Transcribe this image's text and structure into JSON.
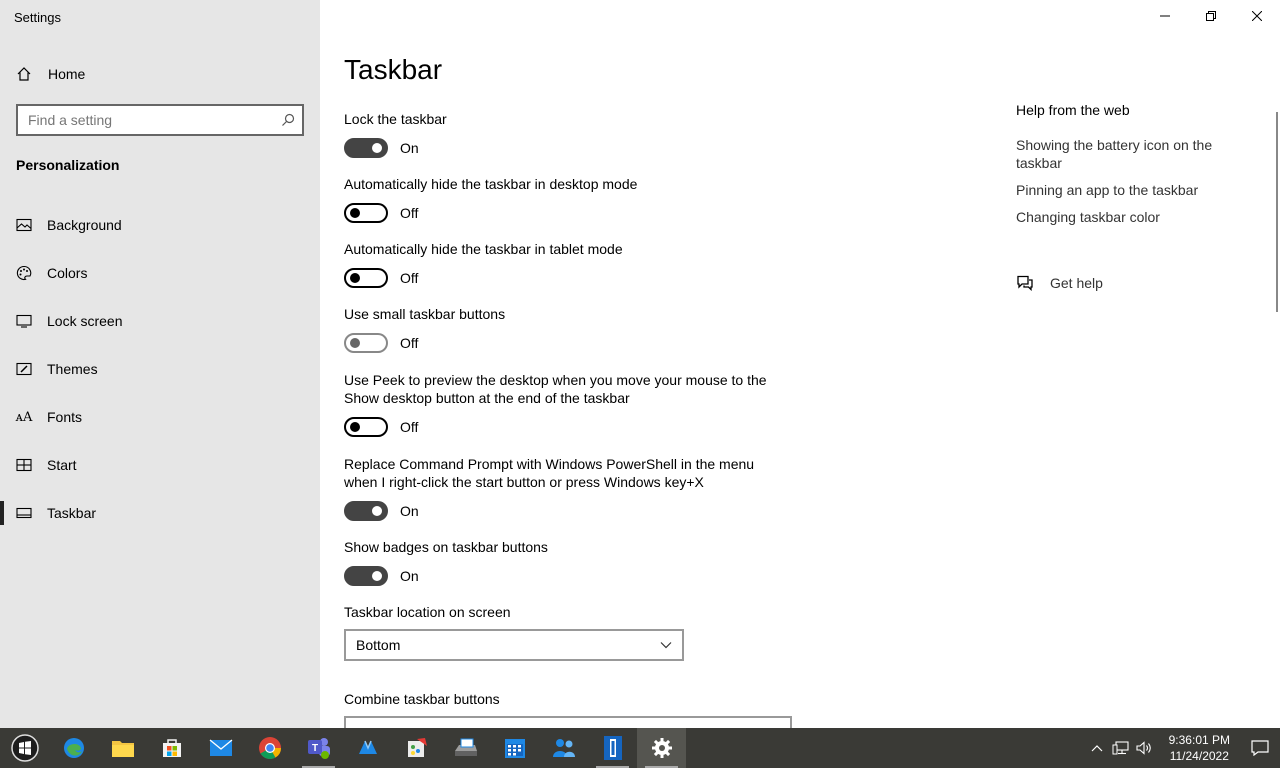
{
  "window": {
    "title": "Settings"
  },
  "sidebar": {
    "home_label": "Home",
    "search_placeholder": "Find a setting",
    "section_title": "Personalization",
    "items": [
      {
        "label": "Background",
        "icon": "picture-icon"
      },
      {
        "label": "Colors",
        "icon": "palette-icon"
      },
      {
        "label": "Lock screen",
        "icon": "monitor-icon"
      },
      {
        "label": "Themes",
        "icon": "brush-icon"
      },
      {
        "label": "Fonts",
        "icon": "font-icon"
      },
      {
        "label": "Start",
        "icon": "start-grid-icon"
      },
      {
        "label": "Taskbar",
        "icon": "taskbar-icon",
        "selected": true
      }
    ]
  },
  "main": {
    "title": "Taskbar",
    "settings": [
      {
        "label": "Lock the taskbar",
        "state": "On"
      },
      {
        "label": "Automatically hide the taskbar in desktop mode",
        "state": "Off"
      },
      {
        "label": "Automatically hide the taskbar in tablet mode",
        "state": "Off"
      },
      {
        "label": "Use small taskbar buttons",
        "state": "Off"
      },
      {
        "label": "Use Peek to preview the desktop when you move your mouse to the Show desktop button at the end of the taskbar",
        "state": "Off"
      },
      {
        "label": "Replace Command Prompt with Windows PowerShell in the menu when I right-click the start button or press Windows key+X",
        "state": "On"
      },
      {
        "label": "Show badges on taskbar buttons",
        "state": "On"
      }
    ],
    "location_label": "Taskbar location on screen",
    "location_value": "Bottom",
    "combine_label": "Combine taskbar buttons"
  },
  "help": {
    "title": "Help from the web",
    "links": [
      "Showing the battery icon on the taskbar",
      "Pinning an app to the taskbar",
      "Changing taskbar color"
    ],
    "get_help": "Get help"
  },
  "taskbar": {
    "apps": [
      "start-icon",
      "edge-icon",
      "file-explorer-icon",
      "store-icon",
      "mail-icon",
      "chrome-icon",
      "teams-icon",
      "app-icon",
      "paint-icon",
      "scanner-icon",
      "calendar-icon",
      "people-icon",
      "reader-icon",
      "settings-icon"
    ],
    "time": "9:36:01 PM",
    "date": "11/24/2022"
  },
  "colors": {
    "sidebar_bg": "#e6e6e6",
    "taskbar_bg": "#3a3a36",
    "toggle_on": "#444444"
  }
}
